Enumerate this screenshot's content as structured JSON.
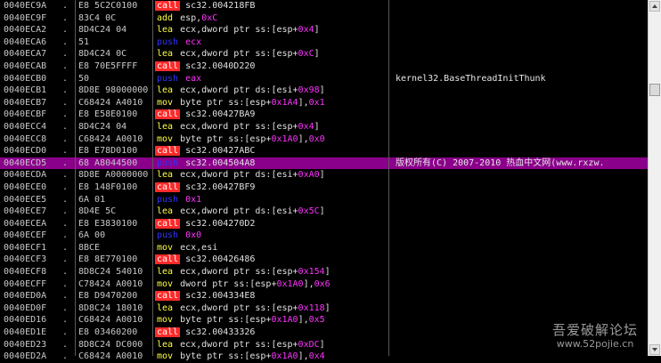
{
  "rows": [
    {
      "address": "0040EC9A",
      "dot": ".",
      "hex": "E8 5C2C0100",
      "mnemonic": "call",
      "operand": "sc32.004218FB",
      "operand_kind": "plain",
      "comment": ""
    },
    {
      "address": "0040EC9F",
      "dot": ".",
      "hex": "83C4 0C",
      "mnemonic": "add",
      "operand": "esp,0xC",
      "operand_kind": "plain",
      "comment": ""
    },
    {
      "address": "0040ECA2",
      "dot": ".",
      "hex": "8D4C24 04",
      "mnemonic": "lea",
      "operand": "ecx,dword ptr ss:[esp+0x4]",
      "operand_kind": "plain",
      "comment": ""
    },
    {
      "address": "0040ECA6",
      "dot": ".",
      "hex": "51",
      "mnemonic": "push",
      "operand": "ecx",
      "operand_kind": "push",
      "comment": ""
    },
    {
      "address": "0040ECA7",
      "dot": ".",
      "hex": "8D4C24 0C",
      "mnemonic": "lea",
      "operand": "ecx,dword ptr ss:[esp+0xC]",
      "operand_kind": "plain",
      "comment": ""
    },
    {
      "address": "0040ECAB",
      "dot": ".",
      "hex": "E8 70E5FFFF",
      "mnemonic": "call",
      "operand": "sc32.0040D220",
      "operand_kind": "plain",
      "comment": ""
    },
    {
      "address": "0040ECB0",
      "dot": ".",
      "hex": "50",
      "mnemonic": "push",
      "operand": "eax",
      "operand_kind": "push",
      "comment": "kernel32.BaseThreadInitThunk"
    },
    {
      "address": "0040ECB1",
      "dot": ".",
      "hex": "8D8E 98000000",
      "mnemonic": "lea",
      "operand": "ecx,dword ptr ds:[esi+0x98]",
      "operand_kind": "plain",
      "comment": ""
    },
    {
      "address": "0040ECB7",
      "dot": ".",
      "hex": "C68424 A4010",
      "mnemonic": "mov",
      "operand": "byte ptr ss:[esp+0x1A4],0x1",
      "operand_kind": "plain",
      "comment": ""
    },
    {
      "address": "0040ECBF",
      "dot": ".",
      "hex": "E8 E58E0100",
      "mnemonic": "call",
      "operand": "sc32.00427BA9",
      "operand_kind": "plain",
      "comment": ""
    },
    {
      "address": "0040ECC4",
      "dot": ".",
      "hex": "8D4C24 04",
      "mnemonic": "lea",
      "operand": "ecx,dword ptr ss:[esp+0x4]",
      "operand_kind": "plain",
      "comment": ""
    },
    {
      "address": "0040ECC8",
      "dot": ".",
      "hex": "C68424 A0010",
      "mnemonic": "mov",
      "operand": "byte ptr ss:[esp+0x1A0],0x0",
      "operand_kind": "plain",
      "comment": ""
    },
    {
      "address": "0040ECD0",
      "dot": ".",
      "hex": "E8 E78D0100",
      "mnemonic": "call",
      "operand": "sc32.00427ABC",
      "operand_kind": "plain",
      "comment": ""
    },
    {
      "address": "0040ECD5",
      "dot": ".",
      "hex": "68 A8044500",
      "mnemonic": "push",
      "operand": "sc32.004504A8",
      "operand_kind": "plain",
      "comment": "版权所有(C) 2007-2010  热血中文网(www.rxzw.",
      "selected": true
    },
    {
      "address": "0040ECDA",
      "dot": ".",
      "hex": "8D8E A0000000",
      "mnemonic": "lea",
      "operand": "ecx,dword ptr ds:[esi+0xA0]",
      "operand_kind": "plain",
      "comment": ""
    },
    {
      "address": "0040ECE0",
      "dot": ".",
      "hex": "E8 148F0100",
      "mnemonic": "call",
      "operand": "sc32.00427BF9",
      "operand_kind": "plain",
      "comment": ""
    },
    {
      "address": "0040ECE5",
      "dot": ".",
      "hex": "6A 01",
      "mnemonic": "push",
      "operand": "0x1",
      "operand_kind": "push",
      "comment": ""
    },
    {
      "address": "0040ECE7",
      "dot": ".",
      "hex": "8D4E 5C",
      "mnemonic": "lea",
      "operand": "ecx,dword ptr ds:[esi+0x5C]",
      "operand_kind": "plain",
      "comment": ""
    },
    {
      "address": "0040ECEA",
      "dot": ".",
      "hex": "E8 E3830100",
      "mnemonic": "call",
      "operand": "sc32.004270D2",
      "operand_kind": "plain",
      "comment": ""
    },
    {
      "address": "0040ECEF",
      "dot": ".",
      "hex": "6A 00",
      "mnemonic": "push",
      "operand": "0x0",
      "operand_kind": "push",
      "comment": ""
    },
    {
      "address": "0040ECF1",
      "dot": ".",
      "hex": "8BCE",
      "mnemonic": "mov",
      "operand": "ecx,esi",
      "operand_kind": "plain",
      "comment": ""
    },
    {
      "address": "0040ECF3",
      "dot": ".",
      "hex": "E8 8E770100",
      "mnemonic": "call",
      "operand": "sc32.00426486",
      "operand_kind": "plain",
      "comment": ""
    },
    {
      "address": "0040ECF8",
      "dot": ".",
      "hex": "8D8C24 54010",
      "mnemonic": "lea",
      "operand": "ecx,dword ptr ss:[esp+0x154]",
      "operand_kind": "plain",
      "comment": ""
    },
    {
      "address": "0040ECFF",
      "dot": ".",
      "hex": "C78424 A0010",
      "mnemonic": "mov",
      "operand": "dword ptr ss:[esp+0x1A0],0x6",
      "operand_kind": "plain",
      "comment": ""
    },
    {
      "address": "0040ED0A",
      "dot": ".",
      "hex": "E8 D9470200",
      "mnemonic": "call",
      "operand": "sc32.004334E8",
      "operand_kind": "plain",
      "comment": ""
    },
    {
      "address": "0040ED0F",
      "dot": ".",
      "hex": "8D8C24 18010",
      "mnemonic": "lea",
      "operand": "ecx,dword ptr ss:[esp+0x118]",
      "operand_kind": "plain",
      "comment": ""
    },
    {
      "address": "0040ED16",
      "dot": ".",
      "hex": "C68424 A0010",
      "mnemonic": "mov",
      "operand": "byte ptr ss:[esp+0x1A0],0x5",
      "operand_kind": "plain",
      "comment": ""
    },
    {
      "address": "0040ED1E",
      "dot": ".",
      "hex": "E8 03460200",
      "mnemonic": "call",
      "operand": "sc32.00433326",
      "operand_kind": "plain",
      "comment": ""
    },
    {
      "address": "0040ED23",
      "dot": ".",
      "hex": "8D8C24 DC000",
      "mnemonic": "lea",
      "operand": "ecx,dword ptr ss:[esp+0xDC]",
      "operand_kind": "plain",
      "comment": ""
    },
    {
      "address": "0040ED2A",
      "dot": ".",
      "hex": "C68424 A0010",
      "mnemonic": "mov",
      "operand": "byte ptr ss:[esp+0x1A0],0x4",
      "operand_kind": "plain",
      "comment": ""
    }
  ],
  "watermark": {
    "line1": "吾爱破解论坛",
    "line2": "www.52pojie.cn"
  },
  "colors": {
    "background": "#000000",
    "selected_row": "#8a008a",
    "call_bg": "#ff2a2a",
    "push_mnemonic": "#3232ff",
    "push_operand": "#ff33ff",
    "yellow_mnemonic": "#ffff40"
  },
  "icons": {
    "scroll_up": "scroll-up-arrow-icon",
    "scroll_down": "scroll-down-arrow-icon"
  }
}
